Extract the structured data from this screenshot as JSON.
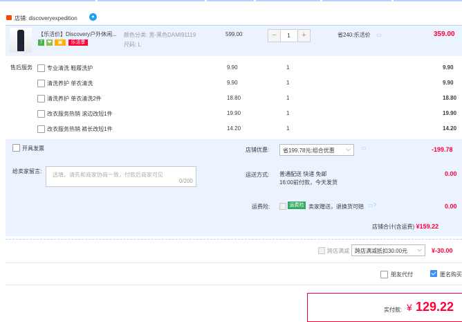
{
  "shop": {
    "label": "店铺: discoveryexpedition"
  },
  "item": {
    "title": "【乐活价】Discovery户外休闲...",
    "tags": [
      "7",
      "❤",
      "▣",
      "乐活季"
    ],
    "sku_color": "颜色分类: 男-黑色DAMI91119",
    "sku_size": "尺码: L",
    "price": "599.00",
    "qty": "1",
    "minus": "−",
    "plus": "+",
    "save": "省240:乐活价",
    "subtotal": "359.00"
  },
  "services": {
    "label": "售后服务",
    "rows": [
      {
        "name": "专业清洗 鞋履洗护",
        "price": "9.90",
        "qty": "1",
        "sum": "9.90"
      },
      {
        "name": "清洗养护 单衣清洗",
        "price": "9.90",
        "qty": "1",
        "sum": "9.90"
      },
      {
        "name": "清洗养护 单衣清洗2件",
        "price": "18.80",
        "qty": "1",
        "sum": "18.80"
      },
      {
        "name": "改衣服务热销 滚边改短1件",
        "price": "19.90",
        "qty": "1",
        "sum": "19.90"
      },
      {
        "name": "改衣服务热销 裤长改短1件",
        "price": "14.20",
        "qty": "1",
        "sum": "14.20"
      }
    ]
  },
  "invoice": {
    "label": "开具发票"
  },
  "note": {
    "label": "给卖家留言:",
    "placeholder": "选填，请先和商家协商一致，付款后商家可见",
    "count": "0/200"
  },
  "promo": {
    "label": "店铺优惠:",
    "selected": "省199.78元:组合优惠",
    "amount": "-199.78"
  },
  "delivery": {
    "label": "运送方式:",
    "line1": "普通配送 快递 免邮",
    "line2": "16:00前付款，今天发货",
    "amount": "0.00"
  },
  "insurance": {
    "label": "运费险:",
    "badge": "运费险",
    "text": "卖家赠送，退换货可赔",
    "amount": "0.00"
  },
  "shop_total": {
    "label": "店铺合计(含运费)",
    "amount": "¥159.22"
  },
  "full_discount": {
    "label": "跨店满减",
    "selected": "跨店满减抵扣30.00元",
    "amount": "¥-30.00"
  },
  "options": {
    "friend_pay": "朋友代付",
    "anonymous": "匿名购买"
  },
  "payment": {
    "label": "实付款:",
    "currency": "¥",
    "amount": "129.22"
  },
  "colors": {
    "accent": "#ff0036",
    "panel": "#eaf3ff",
    "brand_blue": "#3e8ef7"
  }
}
